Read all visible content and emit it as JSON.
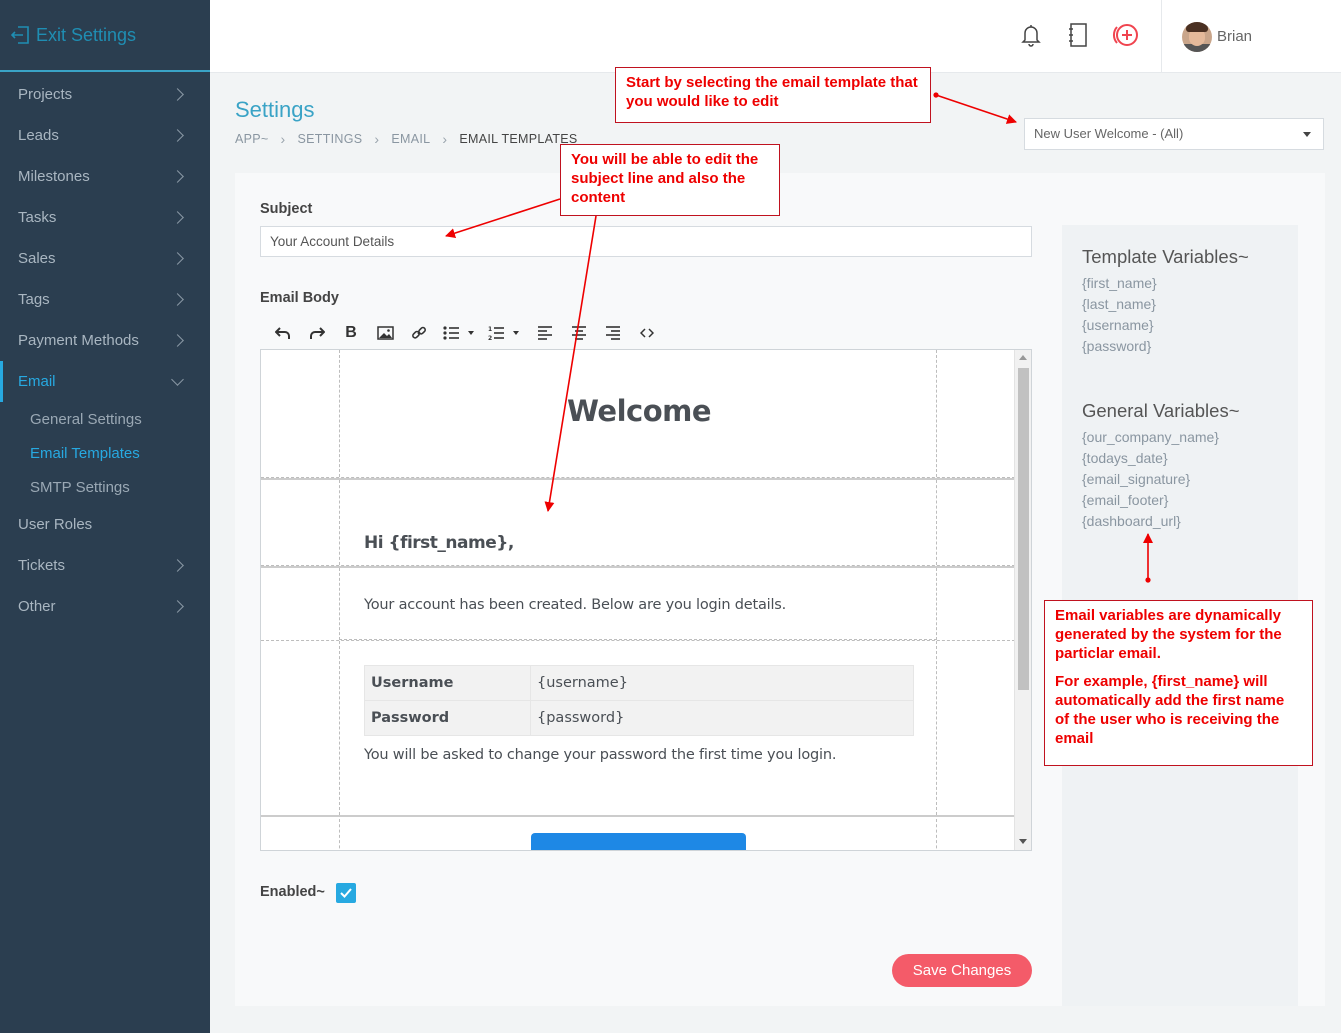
{
  "sidebar": {
    "exit_label": "Exit Settings",
    "items": [
      {
        "label": "Projects"
      },
      {
        "label": "Leads"
      },
      {
        "label": "Milestones"
      },
      {
        "label": "Tasks"
      },
      {
        "label": "Sales"
      },
      {
        "label": "Tags"
      },
      {
        "label": "Payment Methods"
      },
      {
        "label": "Email",
        "active": true
      },
      {
        "label": "User Roles"
      },
      {
        "label": "Tickets"
      },
      {
        "label": "Other"
      }
    ],
    "email_sub": [
      {
        "label": "General Settings"
      },
      {
        "label": "Email Templates",
        "active": true
      },
      {
        "label": "SMTP Settings"
      }
    ]
  },
  "topbar": {
    "icons": [
      "bell-icon",
      "notebook-icon",
      "add-circle-icon"
    ],
    "user_name": "Brian"
  },
  "page": {
    "title": "Settings",
    "breadcrumb": [
      "APP~",
      "SETTINGS",
      "EMAIL",
      "EMAIL TEMPLATES"
    ],
    "template_select": "New User Welcome - (All)"
  },
  "form": {
    "subject_label": "Subject",
    "subject_value": "Your Account Details",
    "body_label": "Email Body",
    "enabled_label": "Enabled~",
    "enabled": true,
    "save_label": "Save Changes"
  },
  "email": {
    "heading": "Welcome",
    "greeting": "Hi {first_name},",
    "intro": "Your account has been created. Below are you login details.",
    "credentials": [
      {
        "key": "Username",
        "value": "{username}"
      },
      {
        "key": "Password",
        "value": "{password}"
      }
    ],
    "note": "You will be asked to change your password the first time you login."
  },
  "variables": {
    "template_title": "Template Variables~",
    "template_vars": [
      "{first_name}",
      "{last_name}",
      "{username}",
      "{password}"
    ],
    "general_title": "General Variables~",
    "general_vars": [
      "{our_company_name}",
      "{todays_date}",
      "{email_signature}",
      "{email_footer}",
      "{dashboard_url}"
    ]
  },
  "annotations": {
    "select_note": "Start by selecting the email template that you would like to edit",
    "edit_note": "You will be able to edit the subject line and also the content",
    "vars_note_1": "Email variables are dynamically generated by the system for the particlar email.",
    "vars_note_2": "For example,  {first_name} will automatically add the first name of the user who is receiving the email"
  },
  "colors": {
    "sidebar_bg": "#2b3e50",
    "accent": "#27a9e1",
    "save_button": "#f45b69",
    "annotation": "#e00000"
  }
}
